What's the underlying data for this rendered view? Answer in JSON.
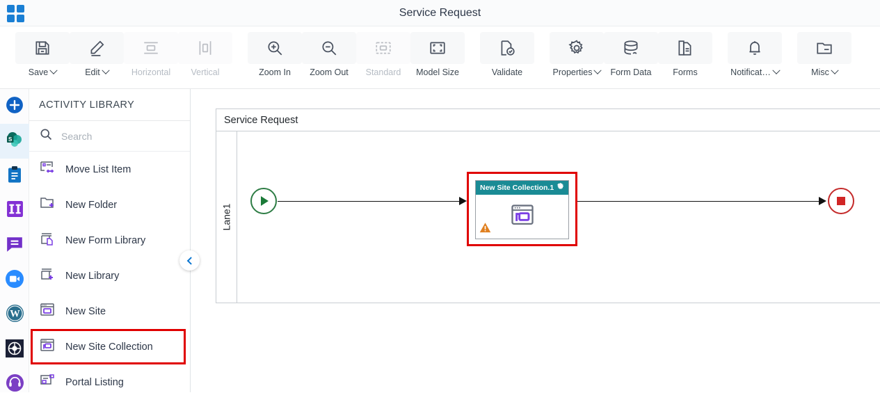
{
  "titlebar": {
    "app_icon": "app-grid-icon",
    "title": "Service Request"
  },
  "toolbar": {
    "buttons": [
      {
        "label": "Save",
        "icon": "save-icon",
        "caret": true,
        "disabled": false
      },
      {
        "label": "Edit",
        "icon": "pencil-icon",
        "caret": true,
        "disabled": false
      },
      {
        "label": "Horizontal",
        "icon": "horizontal-icon",
        "caret": false,
        "disabled": true
      },
      {
        "label": "Vertical",
        "icon": "vertical-icon",
        "caret": false,
        "disabled": true
      },
      {
        "label": "Zoom In",
        "icon": "zoom-in-icon",
        "caret": false,
        "disabled": false
      },
      {
        "label": "Zoom Out",
        "icon": "zoom-out-icon",
        "caret": false,
        "disabled": false
      },
      {
        "label": "Standard",
        "icon": "standard-icon",
        "caret": false,
        "disabled": true
      },
      {
        "label": "Model Size",
        "icon": "model-size-icon",
        "caret": false,
        "disabled": false
      },
      {
        "label": "Validate",
        "icon": "validate-icon",
        "caret": false,
        "disabled": false
      },
      {
        "label": "Properties",
        "icon": "gear-icon",
        "caret": true,
        "disabled": false
      },
      {
        "label": "Form Data",
        "icon": "database-icon",
        "caret": false,
        "disabled": false
      },
      {
        "label": "Forms",
        "icon": "document-icon",
        "caret": false,
        "disabled": false
      },
      {
        "label": "Notificat…",
        "icon": "bell-icon",
        "caret": true,
        "disabled": false
      },
      {
        "label": "Misc",
        "icon": "folder-icon",
        "caret": true,
        "disabled": false
      }
    ]
  },
  "rail": {
    "items": [
      {
        "name": "add-button",
        "icon": "plus-circle-icon",
        "active": false
      },
      {
        "name": "sharepoint",
        "icon": "sharepoint-icon",
        "active": true
      },
      {
        "name": "clipboard",
        "icon": "clipboard-icon",
        "active": false
      },
      {
        "name": "columns",
        "icon": "columns-icon",
        "active": false
      },
      {
        "name": "chat",
        "icon": "chat-icon",
        "active": false
      },
      {
        "name": "zoom-video",
        "icon": "video-icon",
        "active": false
      },
      {
        "name": "wordpress",
        "icon": "wordpress-icon",
        "active": false
      },
      {
        "name": "target",
        "icon": "target-icon",
        "active": false
      },
      {
        "name": "support",
        "icon": "headset-icon",
        "active": false
      }
    ]
  },
  "sidebar": {
    "header": "ACTIVITY LIBRARY",
    "search": {
      "value": "",
      "placeholder": "Search"
    },
    "items": [
      {
        "label": "Move List Item",
        "icon": "move-list-item-icon",
        "highlight": false
      },
      {
        "label": "New Folder",
        "icon": "new-folder-icon",
        "highlight": false
      },
      {
        "label": "New Form Library",
        "icon": "new-form-library-icon",
        "highlight": false
      },
      {
        "label": "New Library",
        "icon": "new-library-icon",
        "highlight": false
      },
      {
        "label": "New Site",
        "icon": "new-site-icon",
        "highlight": false
      },
      {
        "label": "New Site Collection",
        "icon": "new-site-collection-icon",
        "highlight": true
      },
      {
        "label": "Portal Listing",
        "icon": "portal-listing-icon",
        "highlight": false
      }
    ],
    "collapse_icon": "chevron-left-icon"
  },
  "canvas": {
    "pool_title": "Service Request",
    "lane_label": "Lane1",
    "start_node": {
      "name": "start-event",
      "icon": "play-icon"
    },
    "end_node": {
      "name": "end-event",
      "icon": "stop-icon"
    },
    "task": {
      "title": "New Site Collection.1",
      "gear_icon": "gear-icon",
      "body_icon": "new-site-collection-icon",
      "warning_icon": "warning-icon",
      "selected": true
    }
  },
  "colors": {
    "accent_blue": "#1a7fd4",
    "task_header_teal": "#1a8b95",
    "selection_red": "#e00000",
    "start_green": "#2e7d45",
    "end_red": "#c42a2a",
    "warning_orange": "#e08020",
    "icon_purple": "#7b3fe4"
  }
}
